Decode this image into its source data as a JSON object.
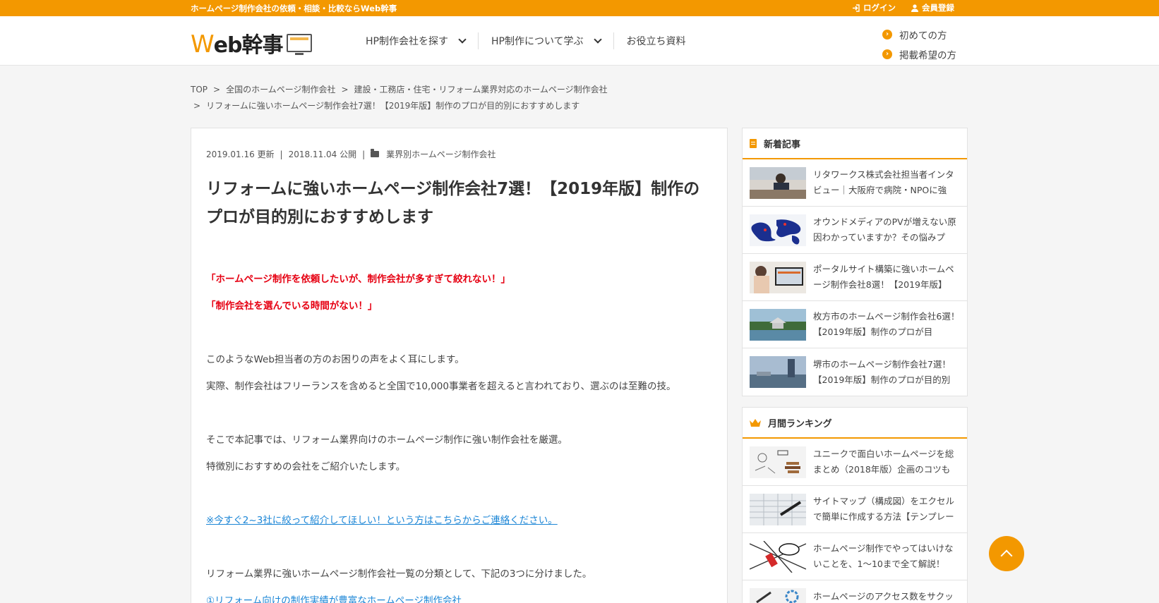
{
  "topbar": {
    "tagline": "ホームページ制作会社の依頼・相談・比較ならWeb幹事",
    "login": "ログイン",
    "register": "会員登録"
  },
  "header": {
    "logo_w": "W",
    "logo_rest": "eb幹事",
    "nav": [
      {
        "label": "HP制作会社を探す"
      },
      {
        "label": "HP制作について学ぶ"
      },
      {
        "label": "お役立ち資料"
      }
    ],
    "side_links": [
      "初めての方",
      "掲載希望の方"
    ]
  },
  "breadcrumb": {
    "items": [
      "TOP",
      "全国のホームページ制作会社",
      "建設・工務店・住宅・リフォーム業界対応のホームページ制作会社",
      "リフォームに強いホームページ制作会社7選！【2019年版】制作のプロが目的別におすすめします"
    ],
    "separator": ">"
  },
  "article": {
    "updated": "2019.01.16 更新",
    "published": "2018.11.04 公開",
    "category": "業界別ホームページ制作会社",
    "title": "リフォームに強いホームページ制作会社7選！【2019年版】制作のプロが目的別におすすめします",
    "quote1": "「ホームページ制作を依頼したいが、制作会社が多すぎて絞れない！」",
    "quote2": "「制作会社を選んでいる時間がない！」",
    "p1": "このようなWeb担当者の方のお困りの声をよく耳にします。",
    "p2": "実際、制作会社はフリーランスを含めると全国で10,000事業者を超えると言われており、選ぶのは至難の技。",
    "p3": "そこで本記事では、リフォーム業界向けのホームページ制作に強い制作会社を厳選。",
    "p4": "特徴別におすすめの会社をご紹介いたします。",
    "cta_link": "※今すぐ2~3社に絞って紹介してほしい！という方はこちらからご連絡ください。",
    "p5": "リフォーム業界に強いホームページ制作会社一覧の分類として、下記の3つに分けました。",
    "list1": "①リフォーム向けの制作実績が豊富なホームページ制作会社"
  },
  "sidebar": {
    "new_title": "新着記事",
    "new_items": [
      "リタワークス株式会社担当者インタビュー｜大阪府で病院・NPOに強",
      "オウンドメディアのPVが増えない原因わかっていますか？その悩みプ",
      "ポータルサイト構築に強いホームページ制作会社8選！【2019年版】",
      "枚方市のホームページ制作会社6選！【2019年版】制作のプロが目",
      "堺市のホームページ制作会社7選！【2019年版】制作のプロが目的別"
    ],
    "rank_title": "月間ランキング",
    "rank_items": [
      "ユニークで面白いホームページを総まとめ（2018年版）企画のコツも",
      "サイトマップ（構成図）をエクセルで簡単に作成する方法【テンプレー",
      "ホームページ制作でやってはいけないことを、1〜10まで全て解説！",
      "ホームページのアクセス数をサクッ"
    ]
  },
  "colors": {
    "accent": "#f39800",
    "red_text": "#e60012",
    "link": "#1a85d6"
  }
}
